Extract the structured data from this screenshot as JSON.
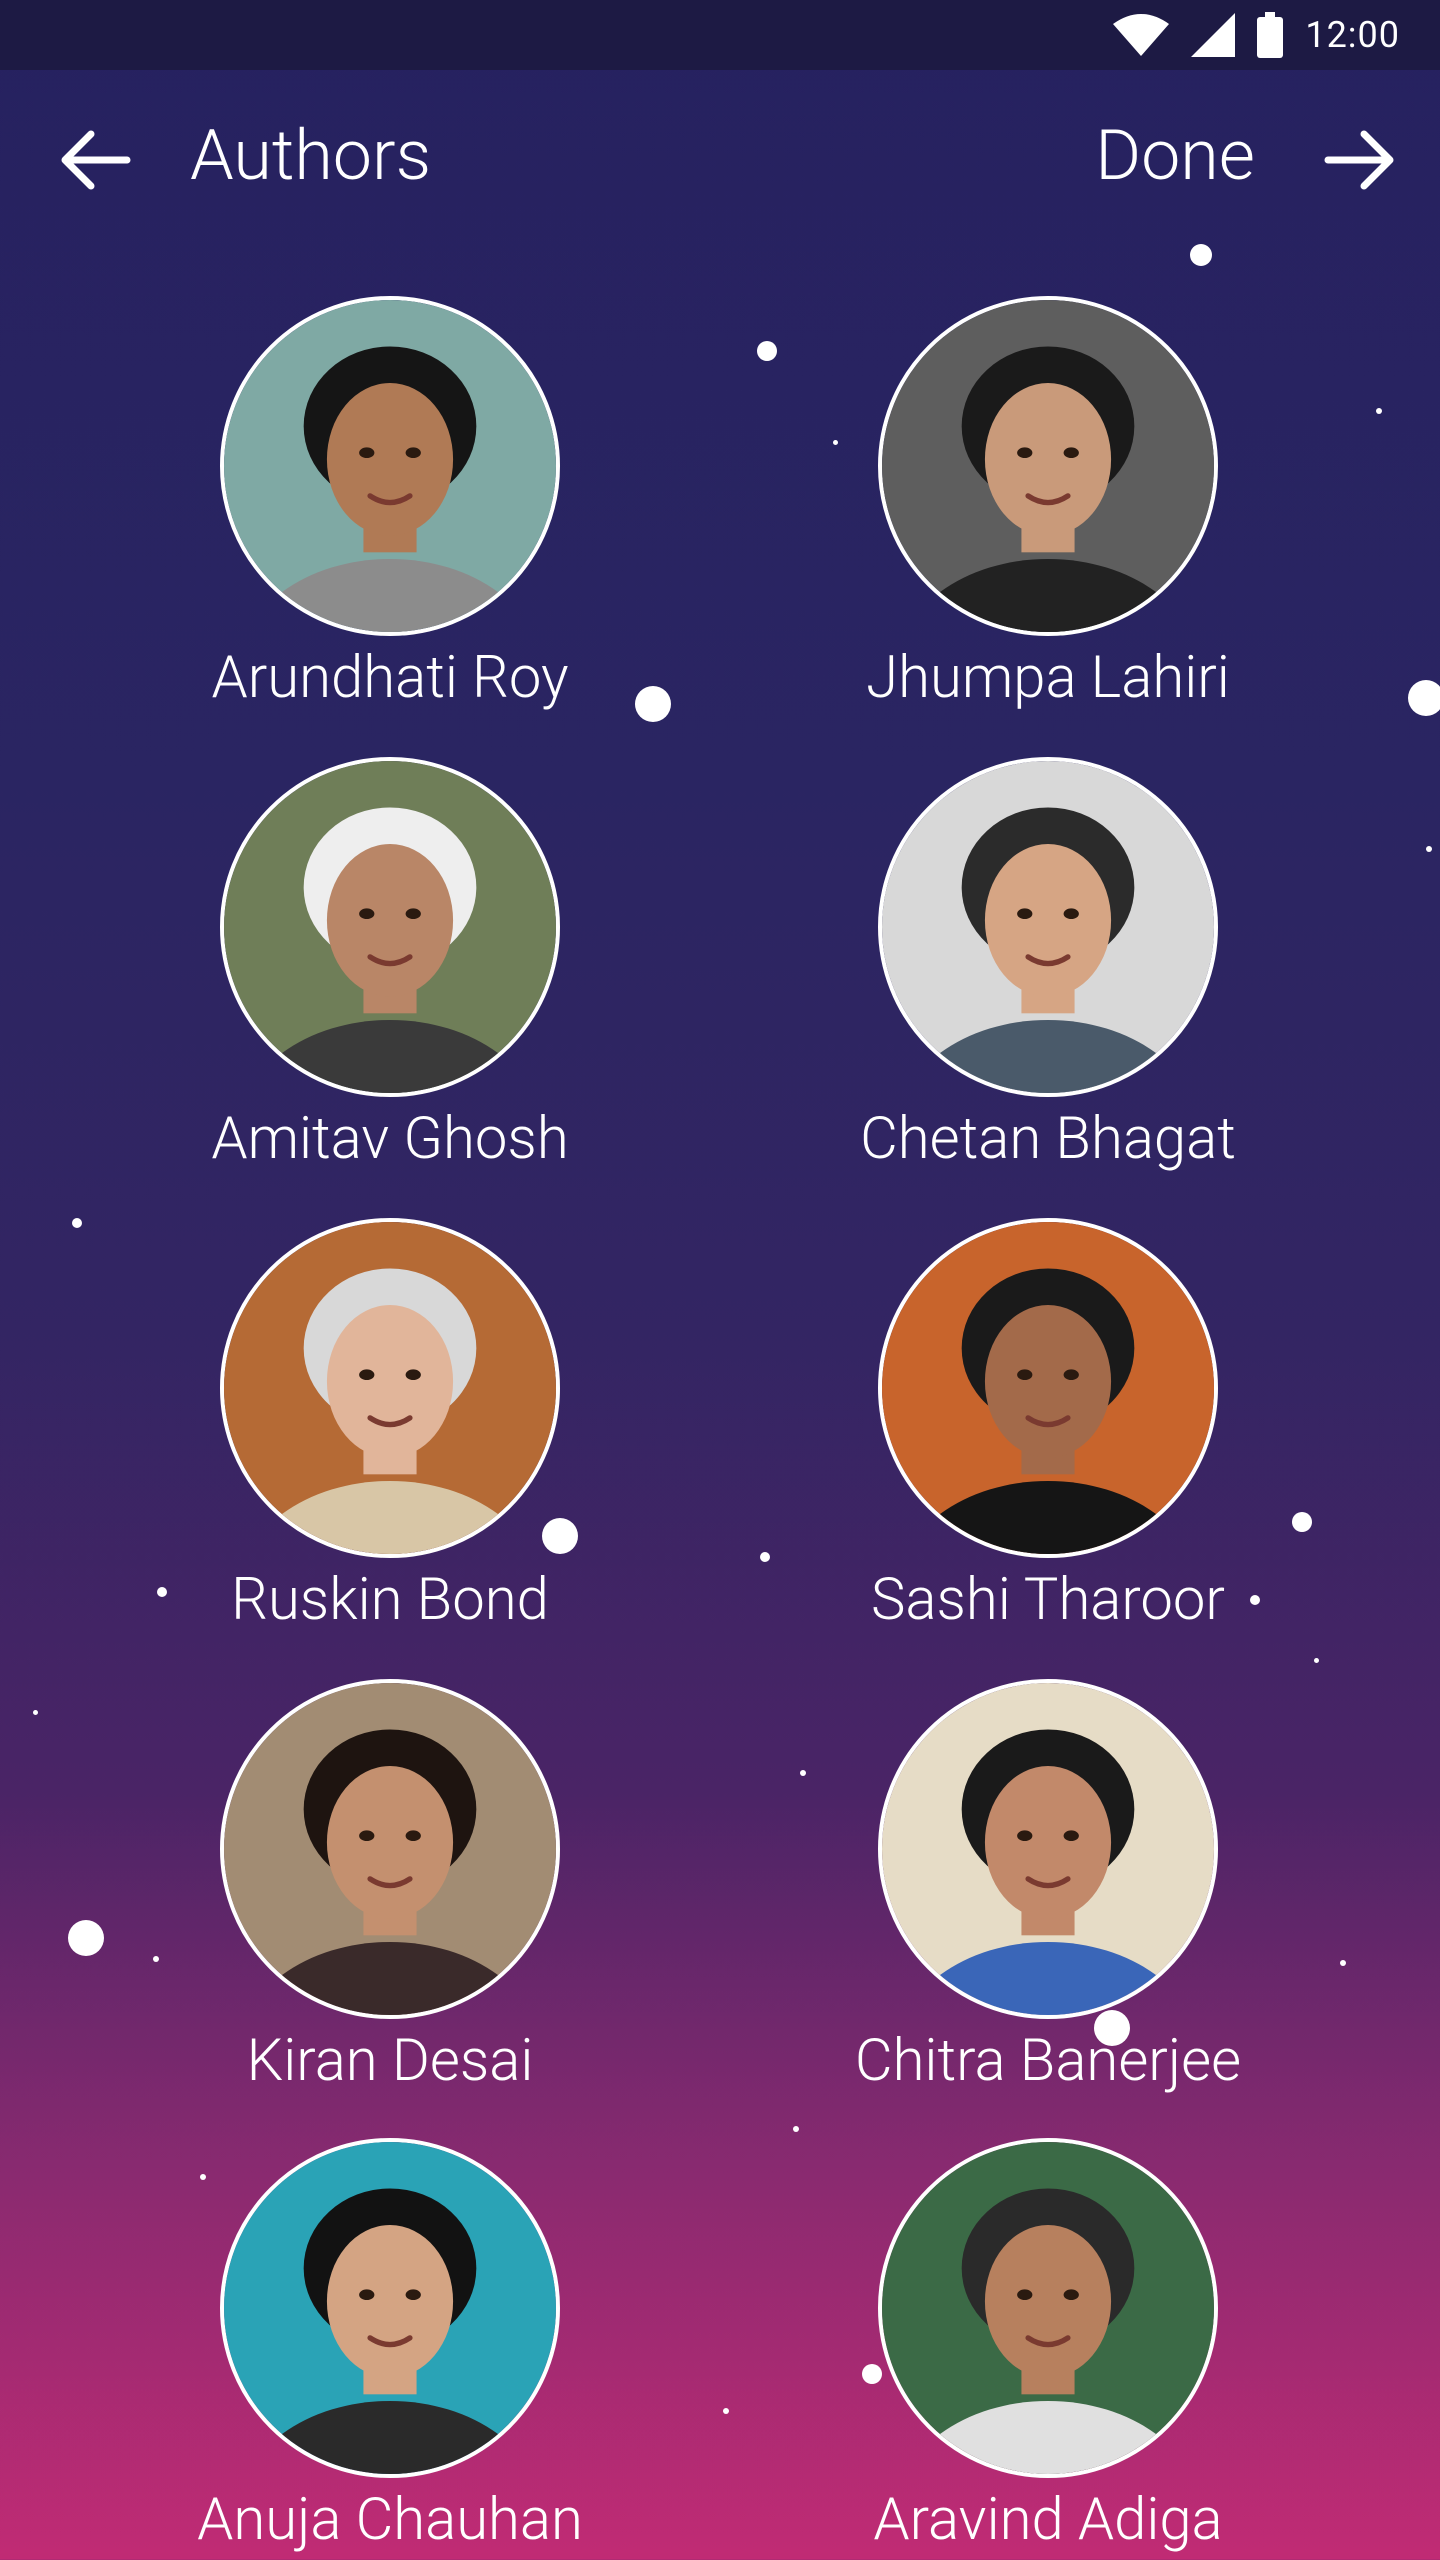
{
  "status_bar": {
    "time": "12:00"
  },
  "toolbar": {
    "title": "Authors",
    "done_label": "Done"
  },
  "authors": [
    {
      "name": "Arundhati Roy",
      "bg": "#7fa9a4",
      "skin": "#b07a55",
      "hair": "#151515",
      "shirt": "#8c8c8c"
    },
    {
      "name": "Jhumpa Lahiri",
      "bg": "#5e5e5e",
      "skin": "#c99a7a",
      "hair": "#1a1a1a",
      "shirt": "#222222"
    },
    {
      "name": "Amitav Ghosh",
      "bg": "#6f7e58",
      "skin": "#b98667",
      "hair": "#eeeeee",
      "shirt": "#3a3a3a"
    },
    {
      "name": "Chetan Bhagat",
      "bg": "#d8d8d8",
      "skin": "#d6a584",
      "hair": "#2b2b2b",
      "shirt": "#4a5a6a"
    },
    {
      "name": "Ruskin Bond",
      "bg": "#b56a35",
      "skin": "#e1b59a",
      "hair": "#d8d8d8",
      "shirt": "#d8c6a6"
    },
    {
      "name": "Sashi Tharoor",
      "bg": "#c8642c",
      "skin": "#a36a4a",
      "hair": "#1a1a1a",
      "shirt": "#151515"
    },
    {
      "name": "Kiran Desai",
      "bg": "#a28c73",
      "skin": "#c4906f",
      "hair": "#1e1410",
      "shirt": "#3a2a2a"
    },
    {
      "name": "Chitra Banerjee",
      "bg": "#e6dcc6",
      "skin": "#c2896a",
      "hair": "#1a1a1a",
      "shirt": "#3a66b8"
    },
    {
      "name": "Anuja Chauhan",
      "bg": "#2aa3b6",
      "skin": "#d4a483",
      "hair": "#121212",
      "shirt": "#2a2a2a"
    },
    {
      "name": "Aravind Adiga",
      "bg": "#3b6a46",
      "skin": "#b7805e",
      "hair": "#2a2a2a",
      "shirt": "#e0e0e0"
    }
  ]
}
